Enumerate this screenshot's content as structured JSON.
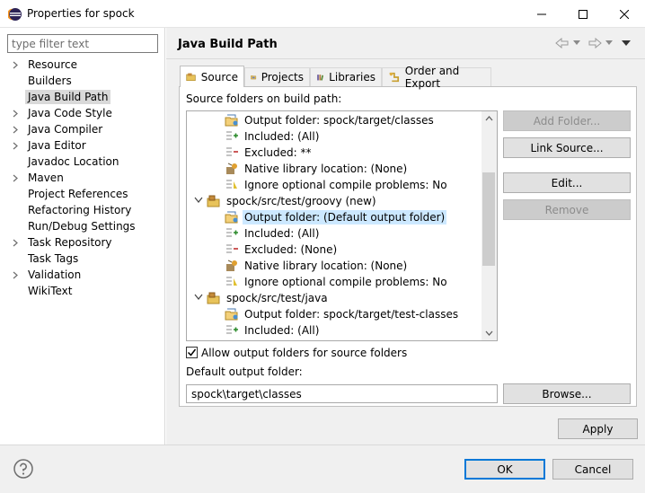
{
  "window": {
    "title": "Properties for spock"
  },
  "left_panel": {
    "filter_placeholder": "type filter text",
    "items": [
      {
        "label": "Resource",
        "expandable": true
      },
      {
        "label": "Builders",
        "expandable": false
      },
      {
        "label": "Java Build Path",
        "expandable": false,
        "selected": true
      },
      {
        "label": "Java Code Style",
        "expandable": true
      },
      {
        "label": "Java Compiler",
        "expandable": true
      },
      {
        "label": "Java Editor",
        "expandable": true
      },
      {
        "label": "Javadoc Location",
        "expandable": false
      },
      {
        "label": "Maven",
        "expandable": true
      },
      {
        "label": "Project References",
        "expandable": false
      },
      {
        "label": "Refactoring History",
        "expandable": false
      },
      {
        "label": "Run/Debug Settings",
        "expandable": false
      },
      {
        "label": "Task Repository",
        "expandable": true
      },
      {
        "label": "Task Tags",
        "expandable": false
      },
      {
        "label": "Validation",
        "expandable": true
      },
      {
        "label": "WikiText",
        "expandable": false
      }
    ]
  },
  "page": {
    "title": "Java Build Path",
    "tabs": [
      {
        "label": "Source",
        "active": true
      },
      {
        "label": "Projects"
      },
      {
        "label": "Libraries"
      },
      {
        "label": "Order and Export"
      }
    ],
    "source_label": "Source folders on build path:",
    "source_tree": [
      {
        "text": "Output folder: spock/target/classes",
        "icon": "output-folder-icon",
        "level": 2
      },
      {
        "text": "Included: (All)",
        "icon": "included-icon",
        "level": 2
      },
      {
        "text": "Excluded: **",
        "icon": "excluded-icon",
        "level": 2
      },
      {
        "text": "Native library location: (None)",
        "icon": "native-library-icon",
        "level": 2
      },
      {
        "text": "Ignore optional compile problems: No",
        "icon": "ignore-problems-icon",
        "level": 2
      },
      {
        "text": "spock/src/test/groovy (new)",
        "icon": "package-folder-icon",
        "level": 1,
        "expanded": true
      },
      {
        "text": "Output folder: (Default output folder)",
        "icon": "output-folder-icon",
        "level": 2,
        "selected": true
      },
      {
        "text": "Included: (All)",
        "icon": "included-icon",
        "level": 2
      },
      {
        "text": "Excluded: (None)",
        "icon": "excluded-icon",
        "level": 2
      },
      {
        "text": "Native library location: (None)",
        "icon": "native-library-icon",
        "level": 2
      },
      {
        "text": "Ignore optional compile problems: No",
        "icon": "ignore-problems-icon",
        "level": 2
      },
      {
        "text": "spock/src/test/java",
        "icon": "package-folder-icon",
        "level": 1,
        "expanded": true
      },
      {
        "text": "Output folder: spock/target/test-classes",
        "icon": "output-folder-icon",
        "level": 2
      },
      {
        "text": "Included: (All)",
        "icon": "included-icon",
        "level": 2
      }
    ],
    "buttons": {
      "add_folder": "Add Folder...",
      "link_source": "Link Source...",
      "edit": "Edit...",
      "remove": "Remove"
    },
    "allow_output_label": "Allow output folders for source folders",
    "allow_output_checked": true,
    "default_output_label": "Default output folder:",
    "default_output_value": "spock\\target\\classes",
    "browse": "Browse...",
    "apply": "Apply"
  },
  "footer": {
    "ok": "OK",
    "cancel": "Cancel"
  }
}
